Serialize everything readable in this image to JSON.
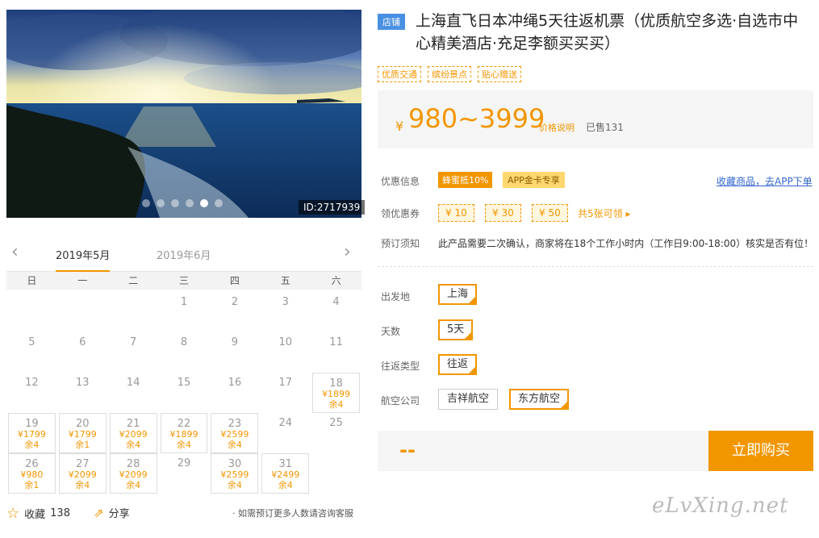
{
  "gallery": {
    "image_id": "ID:2717939",
    "dot_count": 6,
    "active_dot_index": 4
  },
  "calendar": {
    "months": [
      "2019年5月",
      "2019年6月"
    ],
    "weekdays": [
      "日",
      "一",
      "二",
      "三",
      "四",
      "五",
      "六"
    ],
    "days": [
      {
        "d": ""
      },
      {
        "d": ""
      },
      {
        "d": ""
      },
      {
        "d": "1"
      },
      {
        "d": "2"
      },
      {
        "d": "3"
      },
      {
        "d": "4"
      },
      {
        "d": "5"
      },
      {
        "d": "6"
      },
      {
        "d": "7"
      },
      {
        "d": "8"
      },
      {
        "d": "9"
      },
      {
        "d": "10"
      },
      {
        "d": "11"
      },
      {
        "d": "12"
      },
      {
        "d": "13"
      },
      {
        "d": "14"
      },
      {
        "d": "15"
      },
      {
        "d": "16"
      },
      {
        "d": "17"
      },
      {
        "d": "18",
        "p": "¥1899",
        "r": "余4"
      },
      {
        "d": "19",
        "p": "¥1799",
        "r": "余4"
      },
      {
        "d": "20",
        "p": "¥1799",
        "r": "余1"
      },
      {
        "d": "21",
        "p": "¥2099",
        "r": "余4"
      },
      {
        "d": "22",
        "p": "¥1899",
        "r": "余4"
      },
      {
        "d": "23",
        "p": "¥2599",
        "r": "余4"
      },
      {
        "d": "24"
      },
      {
        "d": "25"
      },
      {
        "d": "26",
        "p": "¥980",
        "r": "余1"
      },
      {
        "d": "27",
        "p": "¥2099",
        "r": "余4"
      },
      {
        "d": "28",
        "p": "¥2099",
        "r": "余4"
      },
      {
        "d": "29"
      },
      {
        "d": "30",
        "p": "¥2599",
        "r": "余4"
      },
      {
        "d": "31",
        "p": "¥2499",
        "r": "余4"
      }
    ],
    "footer": {
      "favorite_label": "收藏",
      "favorite_count": "138",
      "share_label": "分享",
      "consult_note": "· 如需预订更多人数请咨询客服"
    }
  },
  "product": {
    "shop_tag": "店铺",
    "title": "上海直飞日本冲绳5天往返机票（优质航空多选·自选市中心精美酒店·充足李额买买买）",
    "features": [
      "优质交通",
      "缤纷景点",
      "贴心赠送"
    ],
    "price": {
      "currency": "¥",
      "range": "980~3999",
      "note": "价格说明",
      "sold": "已售131"
    },
    "offers": {
      "label": "优惠信息",
      "badge1": "蜂蜜抵10%",
      "badge2": "APP金卡专享",
      "link": "收藏商品，去APP下单"
    },
    "coupons": {
      "label": "领优惠券",
      "items": [
        "¥ 10",
        "¥ 30",
        "¥ 50"
      ],
      "more": "共5张可领 ▸"
    },
    "booking": {
      "label": "预订须知",
      "text": "此产品需要二次确认，商家将在18个工作小时内（工作日9:00-18:00）核实是否有位！"
    },
    "options": {
      "departure_label": "出发地",
      "departure": "上海",
      "days_label": "天数",
      "days": "5天",
      "trip_label": "往返类型",
      "trip": "往返",
      "airline_label": "航空公司",
      "airlines": [
        "吉祥航空",
        "东方航空"
      ],
      "airline_selected_index": 1
    },
    "buy": {
      "selected_price": "--",
      "button": "立即购买"
    }
  },
  "watermark": "eLvXing.net",
  "colors": {
    "accent": "#f29600",
    "link": "#3366cc",
    "shop_tag": "#4a90e2"
  }
}
